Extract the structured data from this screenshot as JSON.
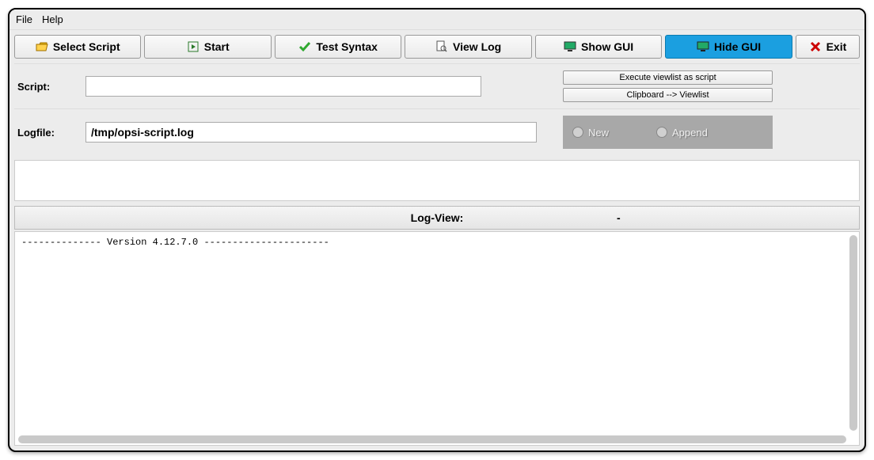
{
  "menu": {
    "file": "File",
    "help": "Help"
  },
  "toolbar": {
    "select_script": "Select Script",
    "start": "Start",
    "test_syntax": "Test Syntax",
    "view_log": "View Log",
    "show_gui": "Show GUI",
    "hide_gui": "Hide GUI",
    "exit": "Exit"
  },
  "form": {
    "script_label": "Script:",
    "script_value": "",
    "logfile_label": "Logfile:",
    "logfile_value": "/tmp/opsi-script.log",
    "exec_viewlist": "Execute viewlist as script",
    "clipboard_viewlist": "Clipboard --> Viewlist",
    "radio_new": "New",
    "radio_append": "Append"
  },
  "logview": {
    "header": "Log-View:",
    "dash": "-",
    "content": "-------------- Version 4.12.7.0 ----------------------"
  }
}
